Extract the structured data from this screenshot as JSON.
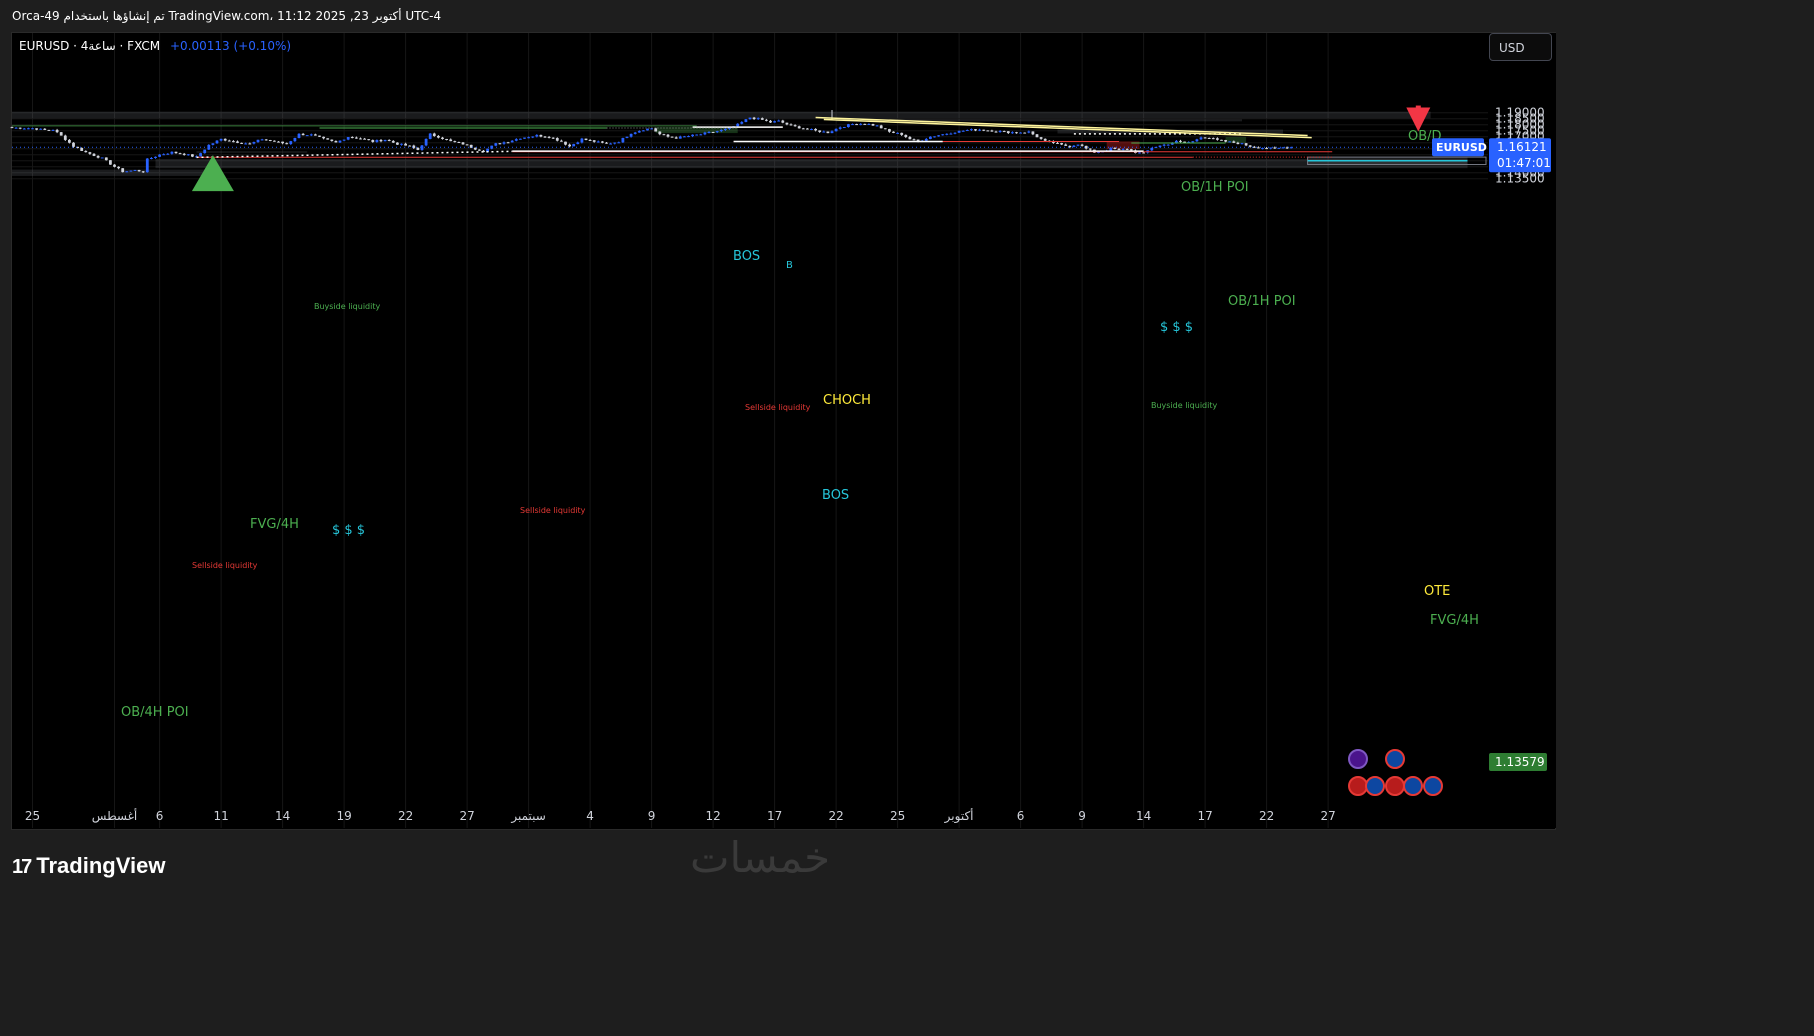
{
  "header": {
    "info": "Orca-49 تم إنشاؤها باستخدام TradingView.com، 11:12 2025 ,23 أكتوبر UTC-4"
  },
  "legend": {
    "symbol": "EURUSD · 4ساعة · FXCM",
    "change": "+0.00113 (+0.10%)"
  },
  "currency_button": "USD",
  "price_tag": {
    "symbol": "EURUSD",
    "price": "1.16121",
    "countdown": "01:47:01"
  },
  "low_tag": "1.13579",
  "logo": "TradingView",
  "watermark": "خمسات",
  "icons": [
    "lightning-event-icon",
    "eu-flag-icon",
    "us-flag-icon",
    "eu-flag-icon",
    "us-flag-icon",
    "eu-flag-icon",
    "eu-flag-icon"
  ],
  "colors": {
    "background": "#000000",
    "bull": "#2962ff",
    "bear": "#d1d4dc",
    "last_price": "#2962ff",
    "green_label": "#4caf50",
    "yellow_label": "#ffeb3b",
    "cyan_label": "#26c6da",
    "sellside": "#e53935"
  },
  "chart_data": {
    "type": "candlestick",
    "symbol": "EURUSD",
    "timeframe": "4ساعة",
    "ylim": [
      1.1332,
      1.1932
    ],
    "y_ticks": [
      "1.19000",
      "1.18500",
      "1.18000",
      "1.17500",
      "1.17000",
      "1.16500",
      "1.16000",
      "1.15500",
      "1.15000",
      "1.14500",
      "1.14000",
      "1.13500"
    ],
    "x_ticks": [
      {
        "label": "25",
        "i": 5
      },
      {
        "label": "أغسطس",
        "i": 25
      },
      {
        "label": "6",
        "i": 36
      },
      {
        "label": "11",
        "i": 51
      },
      {
        "label": "14",
        "i": 66
      },
      {
        "label": "19",
        "i": 81
      },
      {
        "label": "22",
        "i": 96
      },
      {
        "label": "27",
        "i": 111
      },
      {
        "label": "سبتمبر",
        "i": 126
      },
      {
        "label": "4",
        "i": 141
      },
      {
        "label": "9",
        "i": 156
      },
      {
        "label": "12",
        "i": 171
      },
      {
        "label": "17",
        "i": 186
      },
      {
        "label": "22",
        "i": 201
      },
      {
        "label": "25",
        "i": 216
      },
      {
        "label": "أكتوبر",
        "i": 231
      },
      {
        "label": "6",
        "i": 246
      },
      {
        "label": "9",
        "i": 261
      },
      {
        "label": "14",
        "i": 276
      },
      {
        "label": "17",
        "i": 291
      },
      {
        "label": "22",
        "i": 306
      },
      {
        "label": "27",
        "i": 321
      }
    ],
    "bars": 327,
    "last_price": 1.16121,
    "closes": [
      [
        0,
        1.1775
      ],
      [
        5,
        1.177
      ],
      [
        8,
        1.1755
      ],
      [
        10,
        1.176
      ],
      [
        13,
        1.168
      ],
      [
        15,
        1.162
      ],
      [
        18,
        1.157
      ],
      [
        22,
        1.152
      ],
      [
        25,
        1.145
      ],
      [
        27,
        1.141
      ],
      [
        30,
        1.142
      ],
      [
        32,
        1.141
      ],
      [
        33,
        1.151
      ],
      [
        36,
        1.155
      ],
      [
        39,
        1.157
      ],
      [
        42,
        1.1555
      ],
      [
        45,
        1.153
      ],
      [
        48,
        1.163
      ],
      [
        51,
        1.168
      ],
      [
        55,
        1.1655
      ],
      [
        58,
        1.164
      ],
      [
        61,
        1.168
      ],
      [
        64,
        1.166
      ],
      [
        67,
        1.164
      ],
      [
        70,
        1.172
      ],
      [
        73,
        1.1715
      ],
      [
        76,
        1.168
      ],
      [
        79,
        1.165
      ],
      [
        82,
        1.17
      ],
      [
        85,
        1.1685
      ],
      [
        88,
        1.166
      ],
      [
        91,
        1.1675
      ],
      [
        94,
        1.164
      ],
      [
        97,
        1.162
      ],
      [
        99,
        1.159
      ],
      [
        102,
        1.172
      ],
      [
        104,
        1.17
      ],
      [
        107,
        1.166
      ],
      [
        110,
        1.164
      ],
      [
        113,
        1.16
      ],
      [
        115,
        1.158
      ],
      [
        118,
        1.164
      ],
      [
        121,
        1.166
      ],
      [
        124,
        1.169
      ],
      [
        128,
        1.171
      ],
      [
        131,
        1.17
      ],
      [
        134,
        1.166
      ],
      [
        136,
        1.162
      ],
      [
        139,
        1.168
      ],
      [
        142,
        1.166
      ],
      [
        145,
        1.164
      ],
      [
        148,
        1.166
      ],
      [
        151,
        1.173
      ],
      [
        154,
        1.176
      ],
      [
        156,
        1.177
      ],
      [
        158,
        1.172
      ],
      [
        160,
        1.17
      ],
      [
        162,
        1.169
      ],
      [
        165,
        1.1705
      ],
      [
        168,
        1.172
      ],
      [
        171,
        1.174
      ],
      [
        174,
        1.176
      ],
      [
        177,
        1.18
      ],
      [
        180,
        1.186
      ],
      [
        183,
        1.184
      ],
      [
        185,
        1.182
      ],
      [
        187,
        1.183
      ],
      [
        190,
        1.179
      ],
      [
        193,
        1.177
      ],
      [
        196,
        1.175
      ],
      [
        199,
        1.1735
      ],
      [
        202,
        1.178
      ],
      [
        205,
        1.1805
      ],
      [
        208,
        1.181
      ],
      [
        211,
        1.179
      ],
      [
        214,
        1.174
      ],
      [
        217,
        1.172
      ],
      [
        219,
        1.168
      ],
      [
        221,
        1.166
      ],
      [
        224,
        1.17
      ],
      [
        227,
        1.172
      ],
      [
        230,
        1.174
      ],
      [
        233,
        1.1755
      ],
      [
        236,
        1.176
      ],
      [
        239,
        1.175
      ],
      [
        242,
        1.174
      ],
      [
        245,
        1.1735
      ],
      [
        248,
        1.174
      ],
      [
        250,
        1.17
      ],
      [
        252,
        1.166
      ],
      [
        254,
        1.165
      ],
      [
        256,
        1.163
      ],
      [
        258,
        1.162
      ],
      [
        260,
        1.164
      ],
      [
        262,
        1.16
      ],
      [
        264,
        1.157
      ],
      [
        266,
        1.158
      ],
      [
        268,
        1.16
      ],
      [
        270,
        1.159
      ],
      [
        272,
        1.16
      ],
      [
        274,
        1.157
      ],
      [
        276,
        1.156
      ],
      [
        278,
        1.161
      ],
      [
        280,
        1.1625
      ],
      [
        282,
        1.164
      ],
      [
        284,
        1.166
      ],
      [
        286,
        1.165
      ],
      [
        288,
        1.166
      ],
      [
        290,
        1.17
      ],
      [
        292,
        1.169
      ],
      [
        294,
        1.167
      ],
      [
        296,
        1.166
      ],
      [
        298,
        1.165
      ],
      [
        300,
        1.164
      ],
      [
        302,
        1.162
      ],
      [
        304,
        1.161
      ],
      [
        306,
        1.1605
      ],
      [
        308,
        1.16
      ],
      [
        310,
        1.161
      ],
      [
        312,
        1.1612
      ]
    ],
    "annotations": {
      "zones": [
        {
          "label": "OB/D",
          "from": 1.1853,
          "to": 1.1909,
          "i0": 0,
          "i1": 346,
          "color": "gray"
        },
        {
          "label": "OB/1H POI",
          "from": 1.1828,
          "to": 1.1846,
          "i0": 201,
          "i1": 300,
          "color": "gray"
        },
        {
          "label": "OB/1H POI",
          "from": 1.1727,
          "to": 1.176,
          "i0": 255,
          "i1": 310,
          "color": "gray"
        },
        {
          "label": "FVG/4H",
          "from": 1.1566,
          "to": 1.1579,
          "i0": 45,
          "i1": 72,
          "color": "gray"
        },
        {
          "label": "",
          "from": 1.1438,
          "to": 1.1514,
          "i0": 35,
          "i1": 355,
          "color": "gray"
        },
        {
          "label": "OB/4H POI",
          "from": 1.1373,
          "to": 1.1426,
          "i0": 0,
          "i1": 47,
          "color": "gray"
        },
        {
          "label": "FVG/4H",
          "from": 1.1468,
          "to": 1.153,
          "i0": 316,
          "i1": 355,
          "color": "gray"
        },
        {
          "label": "",
          "from": 1.173,
          "to": 1.178,
          "i0": 157,
          "i1": 177,
          "color": "green"
        },
        {
          "label": "",
          "from": 1.1648,
          "to": 1.1697,
          "i0": 296,
          "i1": 301,
          "color": "green"
        },
        {
          "label": "",
          "from": 1.1597,
          "to": 1.1661,
          "i0": 267,
          "i1": 275,
          "color": "red"
        }
      ],
      "labels": [
        "BOS",
        "CHOCH",
        "BOS",
        "OTE",
        "$ $ $",
        "$ $ $",
        "$ $ $",
        "Buyside liquidity",
        "Buyside liquidity",
        "Sellside liquidity",
        "Sellside liquidity",
        "Sellside liquidity",
        "Sellside liquidity",
        "B"
      ],
      "levels": [
        {
          "label": "Buyside liquidity",
          "price": 1.1773,
          "i0": 75,
          "i1": 145
        },
        {
          "label": "Sellside liquidity",
          "price": 1.1529,
          "i0": 45,
          "i1": 288
        },
        {
          "label": "Sellside liquidity",
          "price": 1.1575,
          "i0": 122,
          "i1": 322
        },
        {
          "label": "Sellside liquidity",
          "price": 1.166,
          "i0": 176,
          "i1": 270
        },
        {
          "label": "Buyside liquidity",
          "price": 1.1648,
          "i0": 273,
          "i1": 296
        },
        {
          "label": "BOS",
          "price": 1.178,
          "i0": 166,
          "i1": 188
        },
        {
          "label": "CHOCH",
          "price": 1.166,
          "i0": 176,
          "i1": 227
        },
        {
          "label": "BOS",
          "price": 1.158,
          "i0": 122,
          "i1": 276
        },
        {
          "label": "OTE",
          "price": 1.15,
          "i0": 316,
          "i1": 355
        }
      ],
      "trendlines": [
        {
          "i0": 196,
          "p0": 1.186,
          "i1": 316,
          "p1": 1.171
        },
        {
          "i0": 198,
          "p0": 1.1843,
          "i1": 317,
          "p1": 1.1692
        }
      ],
      "arrows": [
        {
          "direction": "up",
          "color": "green",
          "i": 49,
          "p0": 1.139,
          "p1": 1.148
        },
        {
          "direction": "down",
          "color": "red",
          "i": 343,
          "p0": 1.1858,
          "p1": 1.1793
        }
      ]
    }
  }
}
